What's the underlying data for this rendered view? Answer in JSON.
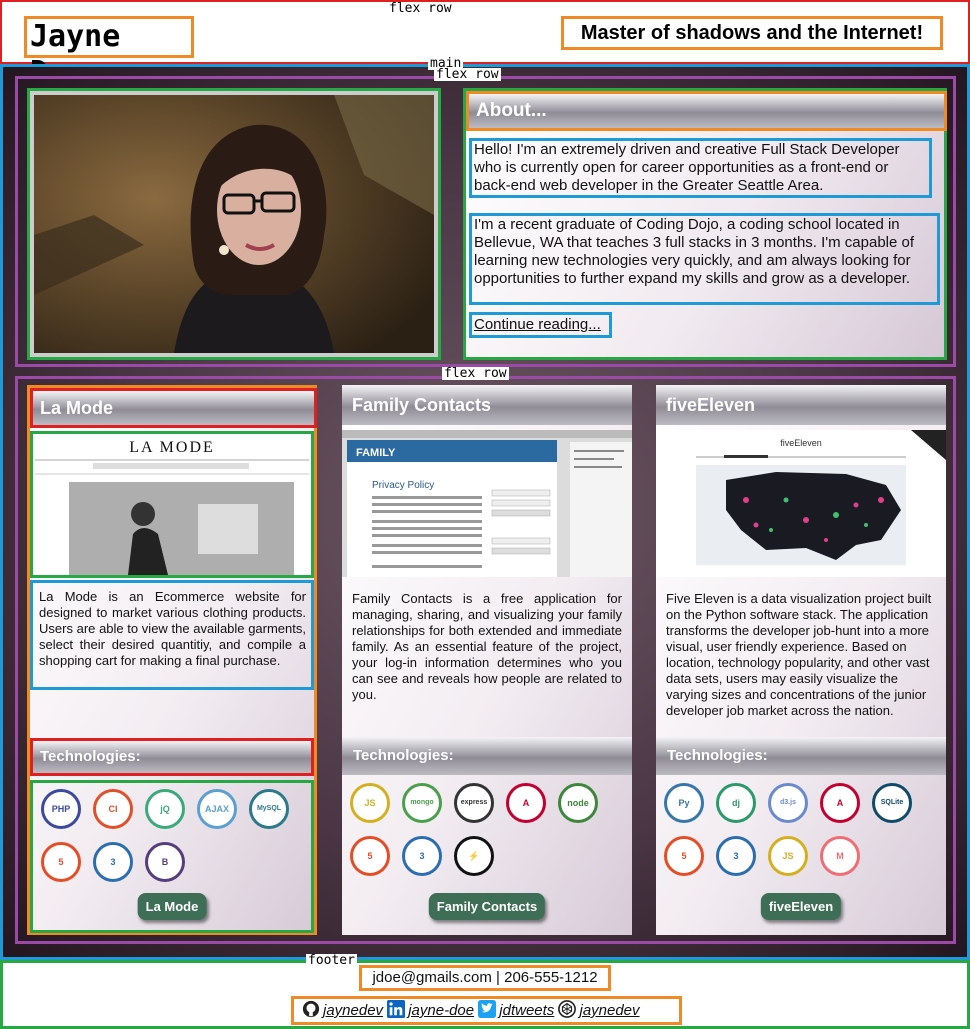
{
  "debug_labels": {
    "header": "flex row",
    "main_label": "main",
    "main_flex": "flex row",
    "row2": "flex row",
    "footer": "footer"
  },
  "header": {
    "name": "Jayne Doe",
    "tagline": "Master of shadows and the Internet!"
  },
  "about": {
    "title": "About...",
    "para1": "Hello! I'm an extremely driven and creative Full Stack Developer who is currently open for career opportunities as a front-end or back-end web developer in the Greater Seattle Area.",
    "para2": "I'm a recent graduate of Coding Dojo, a coding school located in Bellevue, WA that teaches 3 full stacks in 3 months. I'm capable of learning new technologies very quickly, and am always looking for opportunities to further expand my skills and grow as a developer.",
    "link": "Continue reading..."
  },
  "projects": [
    {
      "title": "La Mode",
      "description": "La Mode is an Ecommerce website for designed to market various clothing products. Users are able to view the available garments, select their desired quantitiy, and compile a shopping cart for making a final purchase.",
      "tech_title": "Technologies:",
      "button": "La Mode",
      "icons": [
        {
          "name": "php-icon",
          "label": "PHP",
          "color": "#3b4aa0"
        },
        {
          "name": "codeigniter-icon",
          "label": "CI",
          "color": "#e0502a"
        },
        {
          "name": "jquery-icon",
          "label": "jQ",
          "color": "#3aaa7a"
        },
        {
          "name": "ajax-icon",
          "label": "AJAX",
          "color": "#5aa0d0"
        },
        {
          "name": "mysql-icon",
          "label": "MySQL",
          "color": "#2a7a8a"
        },
        {
          "name": "html5-icon",
          "label": "5",
          "color": "#e44d26"
        },
        {
          "name": "css3-icon",
          "label": "3",
          "color": "#2a6db0"
        },
        {
          "name": "bootstrap-icon",
          "label": "B",
          "color": "#563d7c"
        }
      ],
      "screenshot": {
        "heading": "LA MODE"
      }
    },
    {
      "title": "Family Contacts",
      "description": "Family Contacts is a free application for managing, sharing, and visualizing your family relationships for both extended and immediate family. As an essential feature of the project, your log-in information determines who you can see and reveals how people are related to you.",
      "tech_title": "Technologies:",
      "button": "Family Contacts",
      "icons": [
        {
          "name": "javascript-icon",
          "label": "JS",
          "color": "#d4b020"
        },
        {
          "name": "mongodb-icon",
          "label": "mongo",
          "color": "#4aa04a"
        },
        {
          "name": "express-icon",
          "label": "express",
          "color": "#333333"
        },
        {
          "name": "angular-icon",
          "label": "A",
          "color": "#c3002f"
        },
        {
          "name": "nodejs-icon",
          "label": "node",
          "color": "#3c873a"
        },
        {
          "name": "html5-icon",
          "label": "5",
          "color": "#e44d26"
        },
        {
          "name": "css3-icon",
          "label": "3",
          "color": "#2a6db0"
        },
        {
          "name": "socketio-icon",
          "label": "⚡",
          "color": "#111111"
        }
      ],
      "screenshot": {
        "heading": "Privacy Policy"
      }
    },
    {
      "title": "fiveEleven",
      "description": "Five Eleven is a data visualization project built on the Python software stack. The application transforms the developer job-hunt into a more visual, user friendly experience. Based on location, technology popularity, and other vast data sets, users may easily visualize the varying sizes and concentrations of the junior developer job market across the nation.",
      "tech_title": "Technologies:",
      "button": "fiveEleven",
      "icons": [
        {
          "name": "python-icon",
          "label": "Py",
          "color": "#3776ab"
        },
        {
          "name": "django-icon",
          "label": "dj",
          "color": "#2a9a6a"
        },
        {
          "name": "d3js-icon",
          "label": "d3.js",
          "color": "#6a8ad0"
        },
        {
          "name": "angular-icon",
          "label": "A",
          "color": "#c3002f"
        },
        {
          "name": "sqlite-icon",
          "label": "SQLite",
          "color": "#0f4a6a"
        },
        {
          "name": "html5-icon",
          "label": "5",
          "color": "#e44d26"
        },
        {
          "name": "css3-icon",
          "label": "3",
          "color": "#2a6db0"
        },
        {
          "name": "javascript-icon",
          "label": "JS",
          "color": "#d4b020"
        },
        {
          "name": "materialize-icon",
          "label": "M",
          "color": "#ee6e73"
        }
      ],
      "screenshot": {
        "heading": "fiveEleven"
      }
    }
  ],
  "footer": {
    "contact": "jdoe@gmails.com | 206-555-1212",
    "github": "jaynedev",
    "linkedin": "jayne-doe",
    "twitter": "jdtweets",
    "codepen": "jaynedev"
  }
}
